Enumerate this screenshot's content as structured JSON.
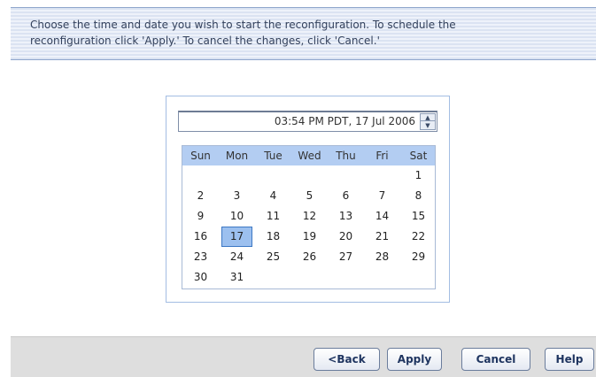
{
  "instructions": {
    "line1": "Choose the time and date you wish to start the reconfiguration.  To schedule the",
    "line2": "reconfiguration click 'Apply.' To cancel the changes, click 'Cancel.'"
  },
  "datetime_spinner": {
    "value": "03:54 PM PDT, 17 Jul 2006",
    "up_icon": "spin-up-arrow",
    "down_icon": "spin-down-arrow"
  },
  "calendar": {
    "weekdays": [
      "Sun",
      "Mon",
      "Tue",
      "Wed",
      "Thu",
      "Fri",
      "Sat"
    ],
    "days": [
      "",
      "",
      "",
      "",
      "",
      "",
      "1",
      "2",
      "3",
      "4",
      "5",
      "6",
      "7",
      "8",
      "9",
      "10",
      "11",
      "12",
      "13",
      "14",
      "15",
      "16",
      "17",
      "18",
      "19",
      "20",
      "21",
      "22",
      "23",
      "24",
      "25",
      "26",
      "27",
      "28",
      "29",
      "30",
      "31",
      "",
      "",
      "",
      "",
      ""
    ],
    "selected_day": "17",
    "selected_color": "#9cc0ef",
    "header_color": "#b3cdf2"
  },
  "buttons": {
    "back": "<Back",
    "apply": "Apply",
    "cancel": "Cancel",
    "help": "Help"
  },
  "colors": {
    "header_band": "#dbe3f2",
    "footer": "#dedede",
    "button_text": "#1f3560"
  }
}
